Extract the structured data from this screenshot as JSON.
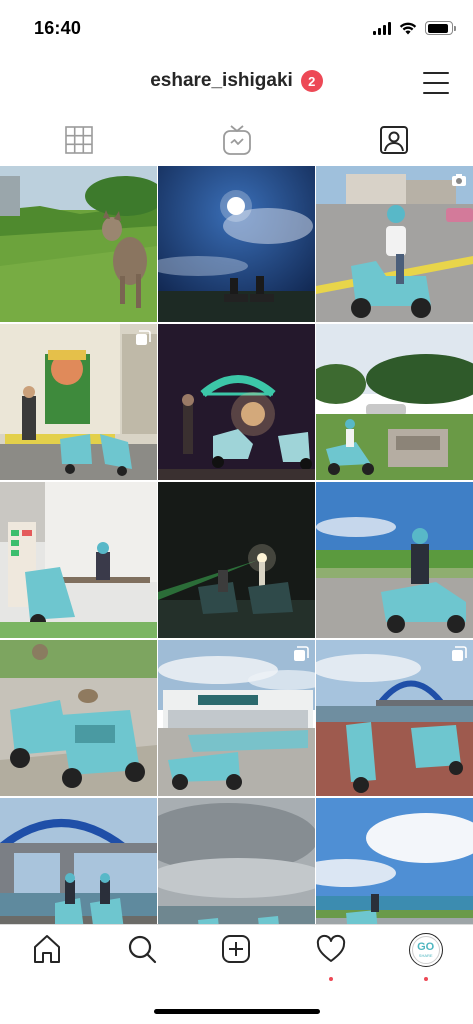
{
  "status_bar": {
    "time": "16:40",
    "signal_icon": "cellular-signal-icon",
    "wifi_icon": "wifi-icon",
    "battery_icon": "battery-icon",
    "battery_level": 0.9
  },
  "header": {
    "username": "eshare_ishigaki",
    "notification_count": "2",
    "menu_icon": "hamburger-menu-icon"
  },
  "tabs": [
    {
      "name": "grid",
      "icon": "grid-icon",
      "active": false
    },
    {
      "name": "igtv",
      "icon": "igtv-icon",
      "active": false
    },
    {
      "name": "tagged",
      "icon": "tagged-user-icon",
      "active": true
    }
  ],
  "grid": {
    "posts": [
      {
        "subject": "cat walking on grass",
        "badge": null
      },
      {
        "subject": "moonlit night sky with scooters",
        "badge": null
      },
      {
        "subject": "rider on teal scooter in street",
        "badge": "camera-icon"
      },
      {
        "subject": "shop statue with scooters",
        "badge": "multiple-photos-icon"
      },
      {
        "subject": "night fireworks with scooters",
        "badge": null
      },
      {
        "subject": "scooter in park with stone monument",
        "badge": null
      },
      {
        "subject": "scooter near bench and vending machines",
        "badge": null
      },
      {
        "subject": "lighthouse at night with scooters",
        "badge": null
      },
      {
        "subject": "rider on scooter by field",
        "badge": null
      },
      {
        "subject": "cat sitting on teal scooters",
        "badge": null
      },
      {
        "subject": "scooters lined up at eshare station",
        "badge": "multiple-photos-icon"
      },
      {
        "subject": "scooters under blue arch bridge",
        "badge": "multiple-photos-icon"
      },
      {
        "subject": "riders under blue bridge",
        "badge": null
      },
      {
        "subject": "cloudy sky over sea",
        "badge": null
      },
      {
        "subject": "blue sky over seaside road",
        "badge": null
      }
    ]
  },
  "bottom_nav": {
    "items": [
      {
        "name": "home",
        "icon": "home-icon",
        "dot": false
      },
      {
        "name": "search",
        "icon": "search-icon",
        "dot": false
      },
      {
        "name": "new-post",
        "icon": "plus-square-icon",
        "dot": false
      },
      {
        "name": "activity",
        "icon": "heart-icon",
        "dot": true
      },
      {
        "name": "profile",
        "icon": "profile-avatar",
        "dot": true
      }
    ],
    "avatar_text_big": "GO",
    "avatar_text_small": "SHARE"
  },
  "colors": {
    "accent_red": "#ed4956",
    "scooter_teal": "#6ec6cf",
    "text": "#262626"
  }
}
